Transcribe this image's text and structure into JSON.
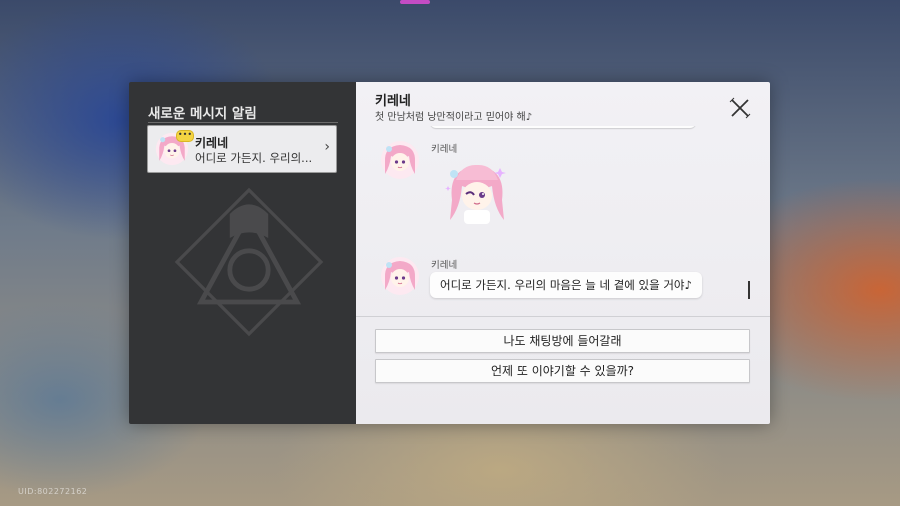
{
  "sidebar": {
    "title": "새로운 메시지 알림",
    "contacts": [
      {
        "name": "키레네",
        "preview": "어디로 가든지. 우리의...",
        "badge": "•••"
      }
    ]
  },
  "chat": {
    "contact_name": "키레네",
    "status": "첫 만남처럼 낭만적이라고 믿어야 해♪",
    "messages": [
      {
        "sender": "키레네",
        "type": "sticker",
        "sticker_icon": "kyrene-sticker"
      },
      {
        "sender": "키레네",
        "type": "text",
        "text": "어디로 가든지. 우리의 마음은 늘 네 곁에 있을 거야♪"
      }
    ],
    "replies": [
      "나도 채팅방에 들어갈래",
      "언제 또 이야기할 수 있을까?"
    ]
  },
  "footer": {
    "uid": "UID:802272162"
  },
  "colors": {
    "sidebar_bg": "#333436",
    "chat_bg": "#f2f1f5",
    "badge": "#f4d442",
    "hair": "#f3a9c8"
  }
}
